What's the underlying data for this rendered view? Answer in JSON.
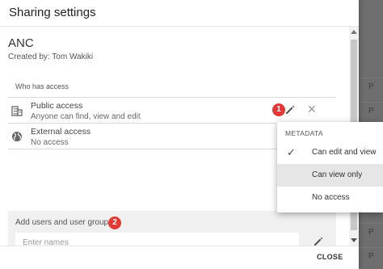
{
  "dialog": {
    "title": "Sharing settings",
    "item_name": "ANC",
    "created_by": "Created by: Tom Wakiki",
    "section_label": "Who has access",
    "access_rows": [
      {
        "title": "Public access",
        "subtitle": "Anyone can find, view and edit",
        "icon": "building-icon",
        "badge": "1"
      },
      {
        "title": "External access",
        "subtitle": "No access",
        "icon": "globe-icon"
      }
    ],
    "add_users": {
      "label": "Add users and user groups",
      "badge": "2",
      "placeholder": "Enter names"
    },
    "close_label": "CLOSE"
  },
  "menu": {
    "header": "METADATA",
    "items": [
      {
        "label": "Can edit and view",
        "checked": true
      },
      {
        "label": "Can view only",
        "highlighted": true
      },
      {
        "label": "No access"
      }
    ]
  },
  "background": {
    "row_letters": [
      "P",
      "P",
      "P",
      "P",
      "P",
      "P",
      "P",
      "P",
      "P",
      "P"
    ]
  },
  "colors": {
    "badge": "#e53935",
    "menu_highlight": "#e6e6e6"
  }
}
